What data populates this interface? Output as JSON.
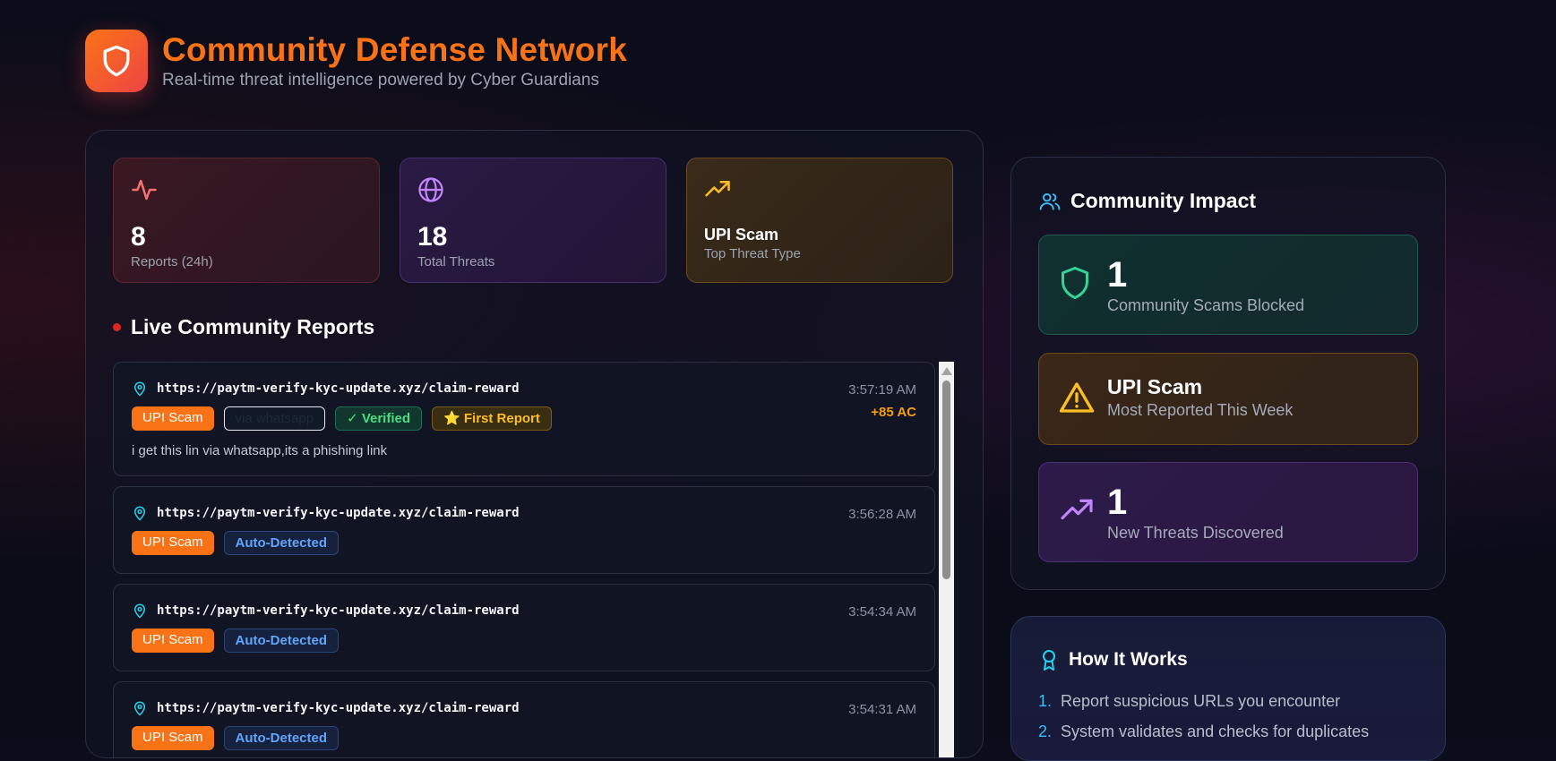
{
  "header": {
    "title": "Community Defense Network",
    "subtitle": "Real-time threat intelligence powered by Cyber Guardians"
  },
  "stats": [
    {
      "value": "8",
      "label": "Reports (24h)",
      "icon": "activity-icon"
    },
    {
      "value": "18",
      "label": "Total Threats",
      "icon": "globe-icon"
    },
    {
      "value": "UPI Scam",
      "label": "Top Threat Type",
      "icon": "trending-up-icon"
    }
  ],
  "feed": {
    "title": "Live Community Reports",
    "reports": [
      {
        "url": "https://paytm-verify-kyc-update.xyz/claim-reward",
        "time": "3:57:19 AM",
        "reward": "+85 AC",
        "type": "UPI Scam",
        "via": "via whatsapp",
        "verified": "✓ Verified",
        "first": "⭐ First Report",
        "comment": "i get this lin via whatsapp,its a phishing link"
      },
      {
        "url": "https://paytm-verify-kyc-update.xyz/claim-reward",
        "time": "3:56:28 AM",
        "type": "UPI Scam",
        "source": "Auto-Detected"
      },
      {
        "url": "https://paytm-verify-kyc-update.xyz/claim-reward",
        "time": "3:54:34 AM",
        "type": "UPI Scam",
        "source": "Auto-Detected"
      },
      {
        "url": "https://paytm-verify-kyc-update.xyz/claim-reward",
        "time": "3:54:31 AM",
        "type": "UPI Scam",
        "source": "Auto-Detected"
      }
    ]
  },
  "impact": {
    "title": "Community Impact",
    "items": [
      {
        "value": "1",
        "label": "Community Scams Blocked",
        "icon": "shield-icon"
      },
      {
        "value": "UPI Scam",
        "label": "Most Reported This Week",
        "icon": "warning-icon"
      },
      {
        "value": "1",
        "label": "New Threats Discovered",
        "icon": "trending-up-icon"
      }
    ]
  },
  "how": {
    "title": "How It Works",
    "steps": [
      "Report suspicious URLs you encounter",
      "System validates and checks for duplicates"
    ]
  },
  "colors": {
    "accent": "#f97316",
    "danger": "#ef4444",
    "success": "#4ade80",
    "warning": "#fbbf24",
    "info": "#60a5fa"
  }
}
